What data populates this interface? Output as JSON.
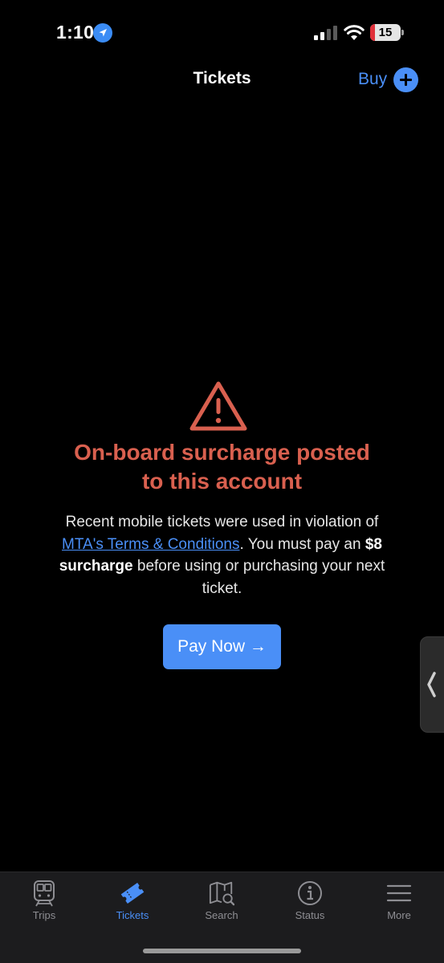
{
  "status_bar": {
    "time": "1:10",
    "battery": "15",
    "battery_level": 0.15,
    "icons": [
      "location-arrow-icon",
      "cellular-signal-icon",
      "wifi-icon",
      "battery-charging-icon"
    ]
  },
  "nav": {
    "title": "Tickets",
    "buy_label": "Buy"
  },
  "alert": {
    "icon": "warning-triangle-icon",
    "title_line1": "On-board surcharge posted",
    "title_line2": "to this account",
    "body_pre": "Recent mobile tickets were used in violation of ",
    "link_text": "MTA's Terms & Conditions",
    "body_mid": ". You must pay an ",
    "surcharge_text": "$8 surcharge",
    "body_post": " before using or purchasing your next ticket.",
    "button_label": "Pay Now →"
  },
  "tabs": [
    {
      "label": "Trips",
      "icon": "train-icon",
      "active": false
    },
    {
      "label": "Tickets",
      "icon": "ticket-icon",
      "active": true
    },
    {
      "label": "Search",
      "icon": "map-search-icon",
      "active": false
    },
    {
      "label": "Status",
      "icon": "info-icon",
      "active": false
    },
    {
      "label": "More",
      "icon": "menu-icon",
      "active": false
    }
  ],
  "colors": {
    "accent": "#4a8ff7",
    "warning": "#d9604f",
    "background": "#000000",
    "tab_bar": "#1c1c1e"
  }
}
